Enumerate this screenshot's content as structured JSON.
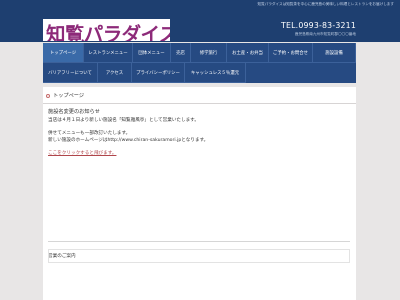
{
  "header": {
    "tagline": "知覧パラダイスは知覧茶を中心に鹿児島の美味しい料理とレストランをお届けします",
    "logo_text": "知覧パラダイス",
    "tel": "TEL.0993-83-3211",
    "address": "鹿児島県南九州市知覧町郡〇〇〇番地"
  },
  "nav": {
    "row1": [
      "トップページ",
      "レストランメニュー",
      "団体メニュー",
      "売店",
      "修学旅行",
      "お土産・お弁当",
      "ご予約・お問合せ",
      "施設設備"
    ],
    "row2": [
      "バリアフリーについて",
      "アクセス",
      "プライバシーポリシー",
      "キャッシュレス５％還元"
    ]
  },
  "main": {
    "breadcrumb": "トップページ",
    "notice_title": "施設名変更のお知らせ",
    "notice_body": "当店は４月１日より新しい施設名「知覧雅風亭」として営業いたします。",
    "menu_notice_1": "併せてメニューも一部改訂いたします。",
    "menu_notice_2": "新しい施設のホームページはhttp://www.chiran-sakuramori.jpとなります。",
    "link_text": "ここをクリックすると飛びます。",
    "footer_label": "営業のご案内"
  }
}
